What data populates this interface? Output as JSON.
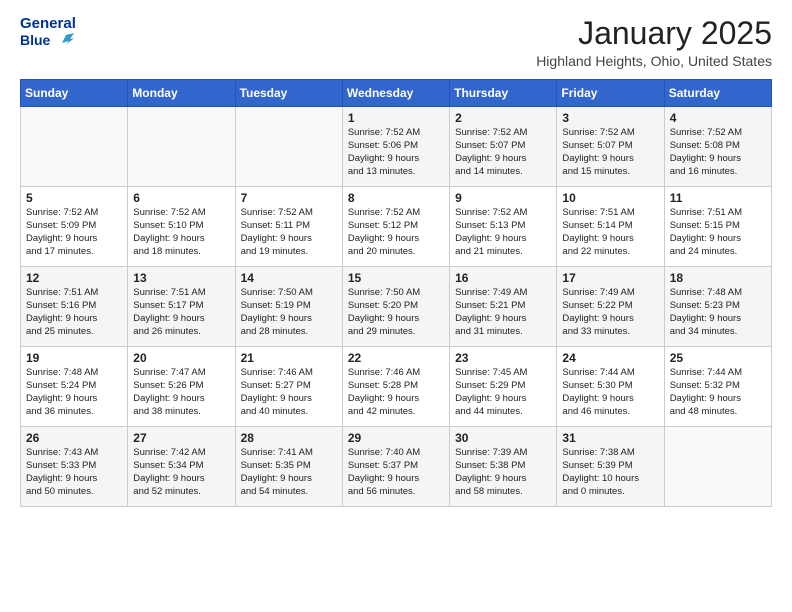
{
  "header": {
    "logo_line1": "General",
    "logo_line2": "Blue",
    "month": "January 2025",
    "location": "Highland Heights, Ohio, United States"
  },
  "weekdays": [
    "Sunday",
    "Monday",
    "Tuesday",
    "Wednesday",
    "Thursday",
    "Friday",
    "Saturday"
  ],
  "weeks": [
    [
      {
        "day": "",
        "info": ""
      },
      {
        "day": "",
        "info": ""
      },
      {
        "day": "",
        "info": ""
      },
      {
        "day": "1",
        "info": "Sunrise: 7:52 AM\nSunset: 5:06 PM\nDaylight: 9 hours\nand 13 minutes."
      },
      {
        "day": "2",
        "info": "Sunrise: 7:52 AM\nSunset: 5:07 PM\nDaylight: 9 hours\nand 14 minutes."
      },
      {
        "day": "3",
        "info": "Sunrise: 7:52 AM\nSunset: 5:07 PM\nDaylight: 9 hours\nand 15 minutes."
      },
      {
        "day": "4",
        "info": "Sunrise: 7:52 AM\nSunset: 5:08 PM\nDaylight: 9 hours\nand 16 minutes."
      }
    ],
    [
      {
        "day": "5",
        "info": "Sunrise: 7:52 AM\nSunset: 5:09 PM\nDaylight: 9 hours\nand 17 minutes."
      },
      {
        "day": "6",
        "info": "Sunrise: 7:52 AM\nSunset: 5:10 PM\nDaylight: 9 hours\nand 18 minutes."
      },
      {
        "day": "7",
        "info": "Sunrise: 7:52 AM\nSunset: 5:11 PM\nDaylight: 9 hours\nand 19 minutes."
      },
      {
        "day": "8",
        "info": "Sunrise: 7:52 AM\nSunset: 5:12 PM\nDaylight: 9 hours\nand 20 minutes."
      },
      {
        "day": "9",
        "info": "Sunrise: 7:52 AM\nSunset: 5:13 PM\nDaylight: 9 hours\nand 21 minutes."
      },
      {
        "day": "10",
        "info": "Sunrise: 7:51 AM\nSunset: 5:14 PM\nDaylight: 9 hours\nand 22 minutes."
      },
      {
        "day": "11",
        "info": "Sunrise: 7:51 AM\nSunset: 5:15 PM\nDaylight: 9 hours\nand 24 minutes."
      }
    ],
    [
      {
        "day": "12",
        "info": "Sunrise: 7:51 AM\nSunset: 5:16 PM\nDaylight: 9 hours\nand 25 minutes."
      },
      {
        "day": "13",
        "info": "Sunrise: 7:51 AM\nSunset: 5:17 PM\nDaylight: 9 hours\nand 26 minutes."
      },
      {
        "day": "14",
        "info": "Sunrise: 7:50 AM\nSunset: 5:19 PM\nDaylight: 9 hours\nand 28 minutes."
      },
      {
        "day": "15",
        "info": "Sunrise: 7:50 AM\nSunset: 5:20 PM\nDaylight: 9 hours\nand 29 minutes."
      },
      {
        "day": "16",
        "info": "Sunrise: 7:49 AM\nSunset: 5:21 PM\nDaylight: 9 hours\nand 31 minutes."
      },
      {
        "day": "17",
        "info": "Sunrise: 7:49 AM\nSunset: 5:22 PM\nDaylight: 9 hours\nand 33 minutes."
      },
      {
        "day": "18",
        "info": "Sunrise: 7:48 AM\nSunset: 5:23 PM\nDaylight: 9 hours\nand 34 minutes."
      }
    ],
    [
      {
        "day": "19",
        "info": "Sunrise: 7:48 AM\nSunset: 5:24 PM\nDaylight: 9 hours\nand 36 minutes."
      },
      {
        "day": "20",
        "info": "Sunrise: 7:47 AM\nSunset: 5:26 PM\nDaylight: 9 hours\nand 38 minutes."
      },
      {
        "day": "21",
        "info": "Sunrise: 7:46 AM\nSunset: 5:27 PM\nDaylight: 9 hours\nand 40 minutes."
      },
      {
        "day": "22",
        "info": "Sunrise: 7:46 AM\nSunset: 5:28 PM\nDaylight: 9 hours\nand 42 minutes."
      },
      {
        "day": "23",
        "info": "Sunrise: 7:45 AM\nSunset: 5:29 PM\nDaylight: 9 hours\nand 44 minutes."
      },
      {
        "day": "24",
        "info": "Sunrise: 7:44 AM\nSunset: 5:30 PM\nDaylight: 9 hours\nand 46 minutes."
      },
      {
        "day": "25",
        "info": "Sunrise: 7:44 AM\nSunset: 5:32 PM\nDaylight: 9 hours\nand 48 minutes."
      }
    ],
    [
      {
        "day": "26",
        "info": "Sunrise: 7:43 AM\nSunset: 5:33 PM\nDaylight: 9 hours\nand 50 minutes."
      },
      {
        "day": "27",
        "info": "Sunrise: 7:42 AM\nSunset: 5:34 PM\nDaylight: 9 hours\nand 52 minutes."
      },
      {
        "day": "28",
        "info": "Sunrise: 7:41 AM\nSunset: 5:35 PM\nDaylight: 9 hours\nand 54 minutes."
      },
      {
        "day": "29",
        "info": "Sunrise: 7:40 AM\nSunset: 5:37 PM\nDaylight: 9 hours\nand 56 minutes."
      },
      {
        "day": "30",
        "info": "Sunrise: 7:39 AM\nSunset: 5:38 PM\nDaylight: 9 hours\nand 58 minutes."
      },
      {
        "day": "31",
        "info": "Sunrise: 7:38 AM\nSunset: 5:39 PM\nDaylight: 10 hours\nand 0 minutes."
      },
      {
        "day": "",
        "info": ""
      }
    ]
  ]
}
